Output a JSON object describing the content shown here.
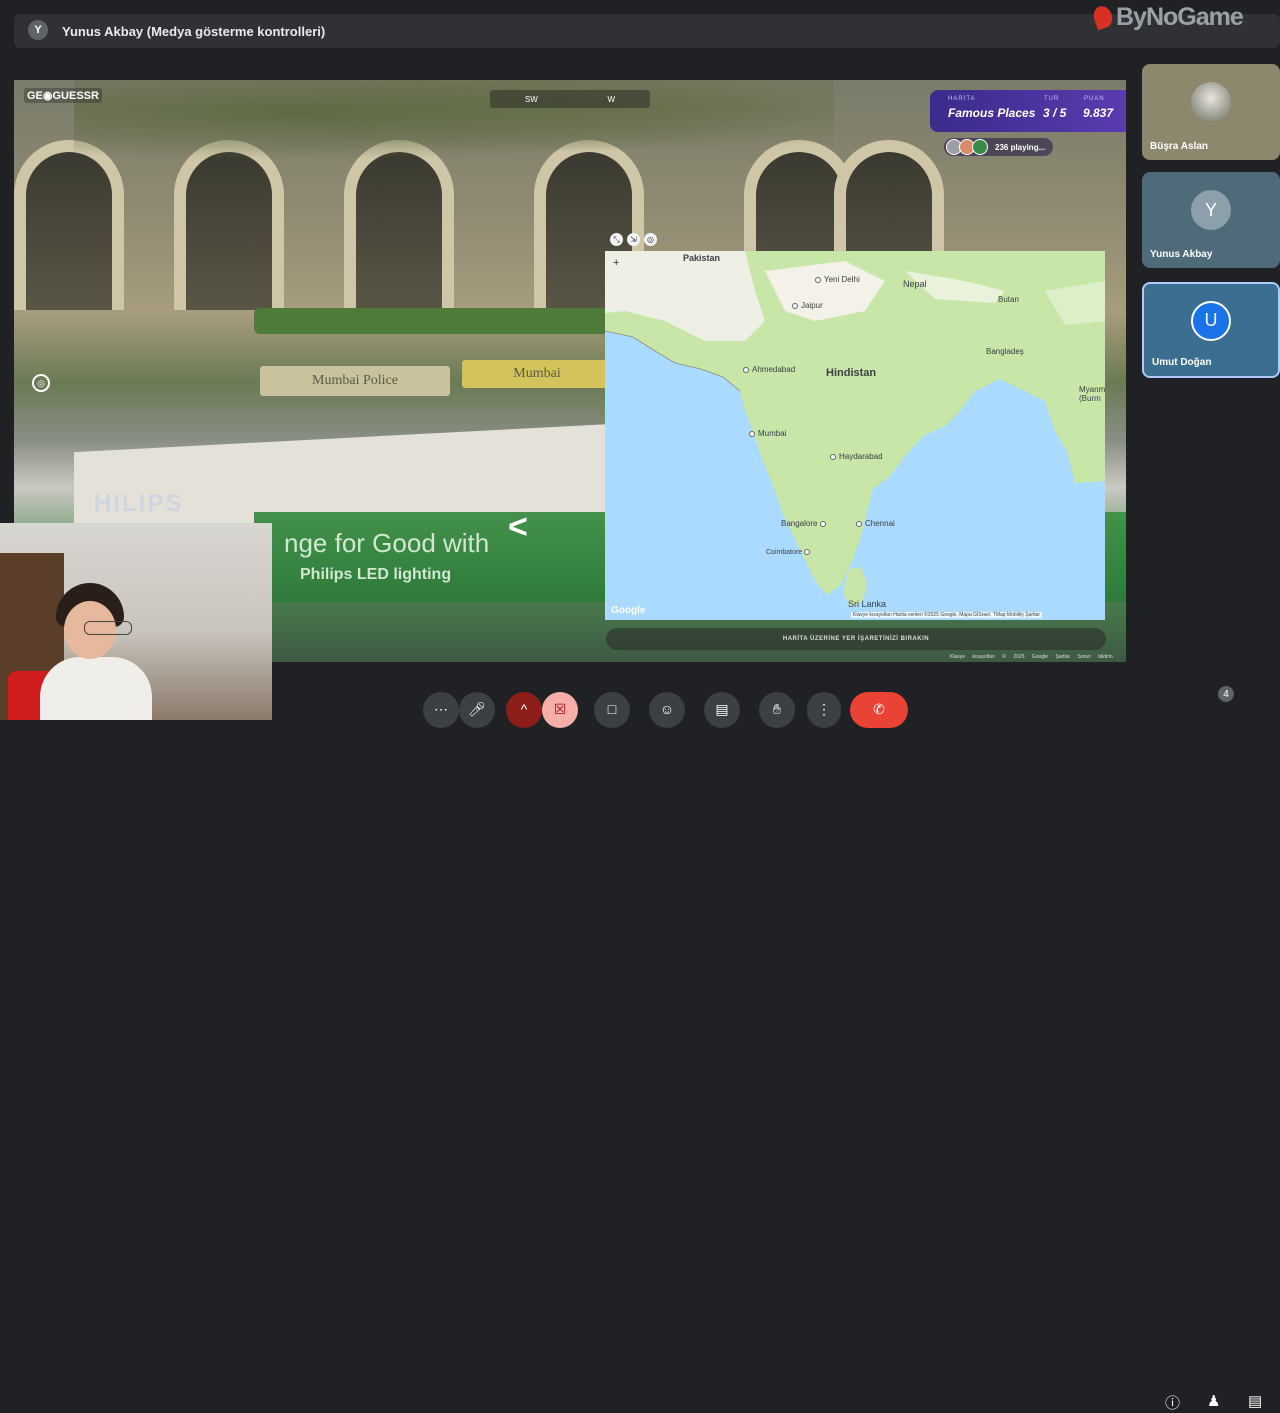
{
  "meeting": {
    "presenter_initial": "Y",
    "presenter_label": "Yunus Akbay (Medya gösterme kontrolleri)"
  },
  "watermark": {
    "brand": "ByNoGame",
    "icon": "bynogame-logo"
  },
  "game": {
    "logo": "GE◉GUESSR",
    "compass": [
      "SW",
      "W"
    ],
    "hud": {
      "map_label": "HARİTA",
      "map_value": "Famous Places",
      "round_label": "TUR",
      "round_value": "3 / 5",
      "score_label": "PUAN",
      "score_value": "9.837"
    },
    "playing_text": "236 playing...",
    "street_signs": [
      "Mumbai Police",
      "Mumbai"
    ],
    "banner_lines": [
      "nge for Good with",
      "Philips LED lighting"
    ],
    "billboard_brand": "HILIPS",
    "guess_prompt": "HARİTA ÜZERİNE YER İŞARETİNİZİ BIRAKIN",
    "street_attribution": "Klavye kısayolları   © 2025 Google   Şartlar   Sorun bildirin",
    "map_tools": [
      "resize-icon",
      "arrows-icon",
      "pin-icon"
    ]
  },
  "map": {
    "countries": [
      "Pakistan",
      "Nepal",
      "Butan",
      "Bangladeş",
      "Hindistan",
      "Myanm (Burm",
      "Sri Lanka"
    ],
    "cities": [
      "Yeni Delhi",
      "Jaipur",
      "Ahmedabad",
      "Mumbai",
      "Haydarabad",
      "Bangalore",
      "Chennai",
      "Coimbatore"
    ],
    "google": "Google",
    "attribution": "Klavye kısayolları   Harita verileri ©2025 Google, Mapa GISrael, TMap Mobility   Şartlar",
    "zoom_plus": "+"
  },
  "participants": [
    {
      "name": "Büşra Aslan",
      "initial": ""
    },
    {
      "name": "Yunus Akbay",
      "initial": "Y"
    },
    {
      "name": "Umut Doğan",
      "initial": "U"
    }
  ],
  "controls": {
    "more": "⋯",
    "mic": "mic-icon",
    "camera_off": "camera-off-icon",
    "present": "present-icon",
    "emoji": "emoji-icon",
    "captions": "captions-icon",
    "raise_hand": "hand-icon",
    "options": "⋮",
    "end_call": "end-call-icon",
    "info": "info-icon",
    "people_count": "4",
    "chat": "chat-icon"
  },
  "colors": {
    "end_call": "#ea4335",
    "hud": "#4b33a0",
    "active_speaker": "#1a73e8"
  }
}
